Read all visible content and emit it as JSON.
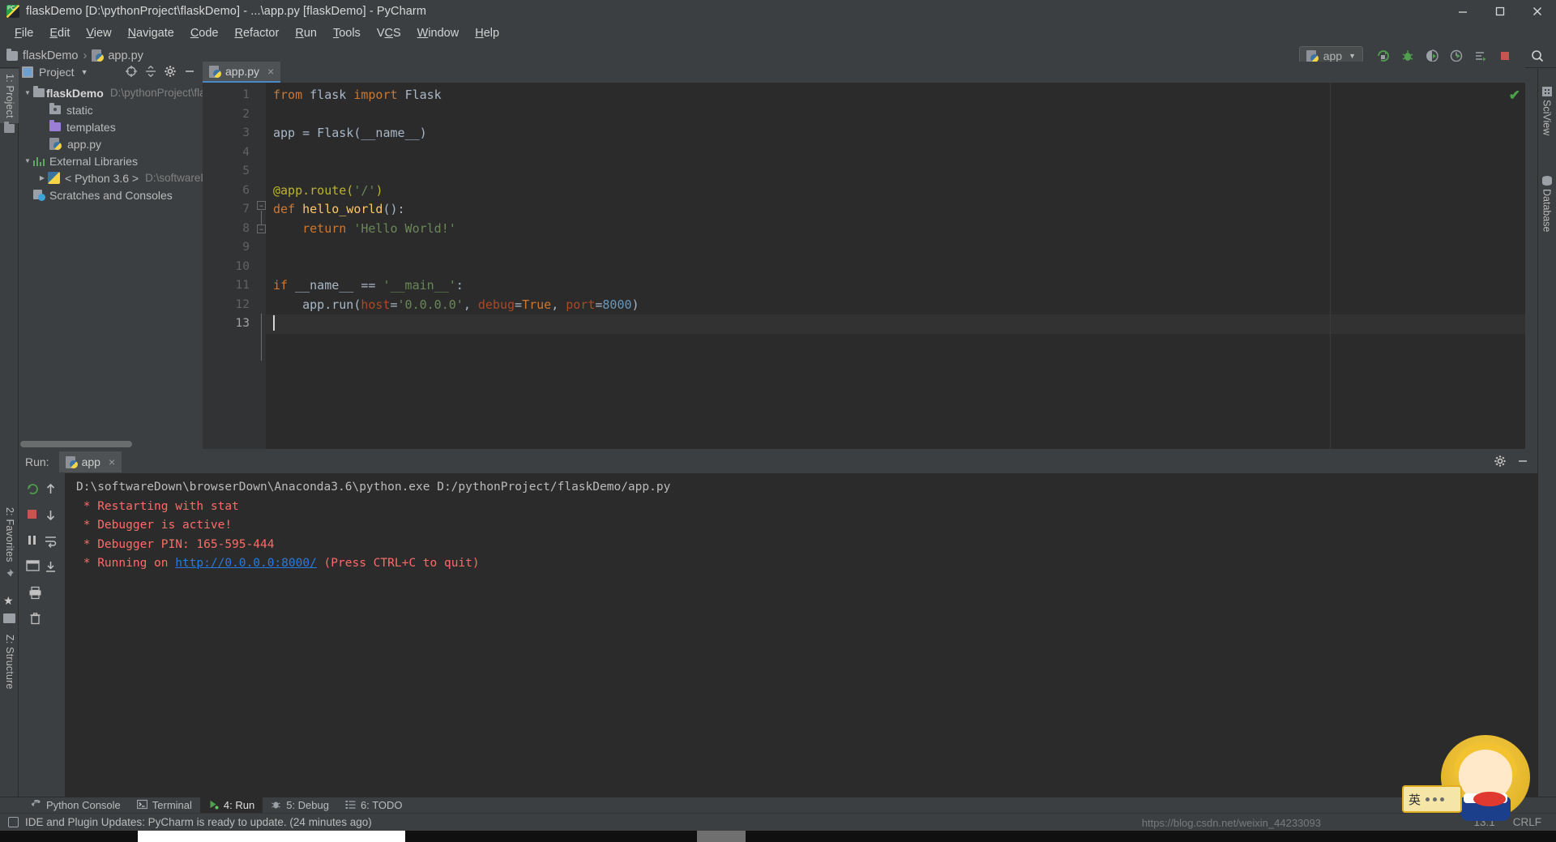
{
  "window": {
    "title": "flaskDemo [D:\\pythonProject\\flaskDemo] - ...\\app.py [flaskDemo] - PyCharm",
    "app_icon": "pycharm-icon",
    "controls": {
      "minimize": "minimize-button",
      "maximize": "maximize-button",
      "close": "close-button"
    }
  },
  "menubar": {
    "items": [
      {
        "label": "File"
      },
      {
        "label": "Edit"
      },
      {
        "label": "View"
      },
      {
        "label": "Navigate"
      },
      {
        "label": "Code"
      },
      {
        "label": "Refactor"
      },
      {
        "label": "Run"
      },
      {
        "label": "Tools"
      },
      {
        "label": "VCS"
      },
      {
        "label": "Window"
      },
      {
        "label": "Help"
      }
    ]
  },
  "breadcrumb": {
    "project": "flaskDemo",
    "separator": "›",
    "file": "app.py"
  },
  "toolbar": {
    "run_config": "app",
    "buttons": [
      {
        "name": "run-button",
        "title": "Run"
      },
      {
        "name": "debug-button",
        "title": "Debug"
      },
      {
        "name": "coverage-button",
        "title": "Run with Coverage"
      },
      {
        "name": "profile-button",
        "title": "Profile"
      },
      {
        "name": "concurrency-button",
        "title": "Concurrency Diagram"
      },
      {
        "name": "stop-button",
        "title": "Stop"
      },
      {
        "name": "search-everywhere-button",
        "title": "Search Everywhere"
      }
    ]
  },
  "left_strip": {
    "tabs": [
      {
        "label": "1: Project",
        "active": true
      },
      {
        "label": "2: Favorites",
        "active": false
      },
      {
        "label": "Z: Structure",
        "active": false
      }
    ]
  },
  "right_strip": {
    "tabs": [
      {
        "label": "SciView",
        "icon": "grid-icon"
      },
      {
        "label": "Database",
        "icon": "database-icon"
      }
    ]
  },
  "project_panel": {
    "title": "Project",
    "header_icons": [
      "target-icon",
      "collapse-all-icon",
      "gear-icon",
      "hide-icon"
    ],
    "tree": [
      {
        "label": "flaskDemo",
        "sub": "D:\\pythonProject\\fla",
        "icon": "folder-icon",
        "indent": 0,
        "arrow": "expanded",
        "bold": true
      },
      {
        "label": "static",
        "sub": "",
        "icon": "folder-dot-icon",
        "indent": 1,
        "arrow": "none",
        "bold": false
      },
      {
        "label": "templates",
        "sub": "",
        "icon": "folder-purple-icon",
        "indent": 1,
        "arrow": "none",
        "bold": false
      },
      {
        "label": "app.py",
        "sub": "",
        "icon": "python-file-icon",
        "indent": 1,
        "arrow": "none",
        "bold": false
      },
      {
        "label": "External Libraries",
        "sub": "",
        "icon": "libraries-icon",
        "indent": 0,
        "arrow": "expanded",
        "bold": false
      },
      {
        "label": "< Python 3.6 >",
        "sub": "D:\\softwareD",
        "icon": "python-sdk-icon",
        "indent": 1,
        "arrow": "collapsed",
        "bold": false
      },
      {
        "label": "Scratches and Consoles",
        "sub": "",
        "icon": "scratches-icon",
        "indent": 0,
        "arrow": "none",
        "bold": false
      }
    ]
  },
  "editor": {
    "tabs": [
      {
        "label": "app.py",
        "icon": "python-file-icon",
        "active": true,
        "close": "×"
      }
    ],
    "line_numbers": [
      "1",
      "2",
      "3",
      "4",
      "5",
      "6",
      "7",
      "8",
      "9",
      "10",
      "11",
      "12",
      "13"
    ],
    "lines": [
      {
        "n": 1,
        "tokens": [
          {
            "t": "from ",
            "c": "kw"
          },
          {
            "t": "flask ",
            "c": "ident"
          },
          {
            "t": "import ",
            "c": "kw"
          },
          {
            "t": "Flask",
            "c": "ident"
          }
        ]
      },
      {
        "n": 2,
        "tokens": []
      },
      {
        "n": 3,
        "tokens": [
          {
            "t": "app = Flask(__name__)",
            "c": "ident"
          }
        ]
      },
      {
        "n": 4,
        "tokens": []
      },
      {
        "n": 5,
        "tokens": []
      },
      {
        "n": 6,
        "tokens": [
          {
            "t": "@app.route(",
            "c": "dec"
          },
          {
            "t": "'/'",
            "c": "str"
          },
          {
            "t": ")",
            "c": "dec"
          }
        ]
      },
      {
        "n": 7,
        "tokens": [
          {
            "t": "def ",
            "c": "kw"
          },
          {
            "t": "hello_world",
            "c": "fn"
          },
          {
            "t": "():",
            "c": "ident"
          }
        ]
      },
      {
        "n": 8,
        "tokens": [
          {
            "t": "    ",
            "c": "ident"
          },
          {
            "t": "return ",
            "c": "kw"
          },
          {
            "t": "'Hello World!'",
            "c": "str"
          }
        ]
      },
      {
        "n": 9,
        "tokens": []
      },
      {
        "n": 10,
        "tokens": []
      },
      {
        "n": 11,
        "tokens": [
          {
            "t": "if ",
            "c": "kw"
          },
          {
            "t": "__name__ == ",
            "c": "ident"
          },
          {
            "t": "'__main__'",
            "c": "str"
          },
          {
            "t": ":",
            "c": "ident"
          }
        ]
      },
      {
        "n": 12,
        "tokens": [
          {
            "t": "    app.run(",
            "c": "ident"
          },
          {
            "t": "host",
            "c": "param"
          },
          {
            "t": "=",
            "c": "ident"
          },
          {
            "t": "'0.0.0.0'",
            "c": "str"
          },
          {
            "t": ", ",
            "c": "ident"
          },
          {
            "t": "debug",
            "c": "param"
          },
          {
            "t": "=",
            "c": "ident"
          },
          {
            "t": "True",
            "c": "kw"
          },
          {
            "t": ", ",
            "c": "ident"
          },
          {
            "t": "port",
            "c": "param"
          },
          {
            "t": "=",
            "c": "ident"
          },
          {
            "t": "8000",
            "c": "num"
          },
          {
            "t": ")",
            "c": "ident"
          }
        ]
      },
      {
        "n": 13,
        "tokens": []
      }
    ],
    "run_gutter_line": 11,
    "caret_line": 13,
    "inspection_status": "✔"
  },
  "run_window": {
    "label": "Run:",
    "tab": "app",
    "tab_close": "×",
    "sidebar_buttons": [
      "rerun-icon",
      "up-arrow-icon",
      "stop-icon",
      "down-arrow-icon",
      "pause-icon",
      "soft-wrap-icon",
      "print-icon",
      "scroll-to-end-icon",
      "trash-icon"
    ],
    "header_buttons": [
      "settings-gear-icon",
      "hide-window-icon"
    ],
    "console": [
      {
        "text": "D:\\softwareDown\\browserDown\\Anaconda3.6\\python.exe D:/pythonProject/flaskDemo/app.py",
        "style": "normal"
      },
      {
        "text": " * Restarting with stat",
        "style": "err"
      },
      {
        "text": " * Debugger is active!",
        "style": "err"
      },
      {
        "text": " * Debugger PIN: 165-595-444",
        "style": "err"
      },
      {
        "text": " * Running on ",
        "style": "err",
        "link": "http://0.0.0.0:8000/",
        "after": " (Press CTRL+C to quit)"
      }
    ]
  },
  "bottom_tabs": [
    {
      "label": "Python Console",
      "icon": "python-console-icon",
      "active": false
    },
    {
      "label": "Terminal",
      "icon": "terminal-icon",
      "active": false
    },
    {
      "label": "4: Run",
      "icon": "run-icon",
      "active": true
    },
    {
      "label": "5: Debug",
      "icon": "debug-icon",
      "active": false
    },
    {
      "label": "6: TODO",
      "icon": "todo-icon",
      "active": false
    }
  ],
  "statusbar": {
    "message": "IDE and Plugin Updates: PyCharm is ready to update. (24 minutes ago)",
    "caret_position": "13:1",
    "line_separator": "CRLF",
    "watermark": "https://blog.csdn.net/weixin_44233093"
  },
  "sticker": {
    "badge_text": "英"
  },
  "colors": {
    "chrome": "#3c3f41",
    "editor_bg": "#2b2b2b",
    "gutter_bg": "#313335",
    "accent_tab": "#4a88c7",
    "keyword": "#cc7832",
    "string": "#6a8759",
    "function": "#ffc66d",
    "decorator": "#bbb529",
    "number": "#6897bb",
    "param": "#aa4926",
    "error_text": "#ff6b68",
    "link": "#287bde",
    "run_green": "#499c54"
  }
}
